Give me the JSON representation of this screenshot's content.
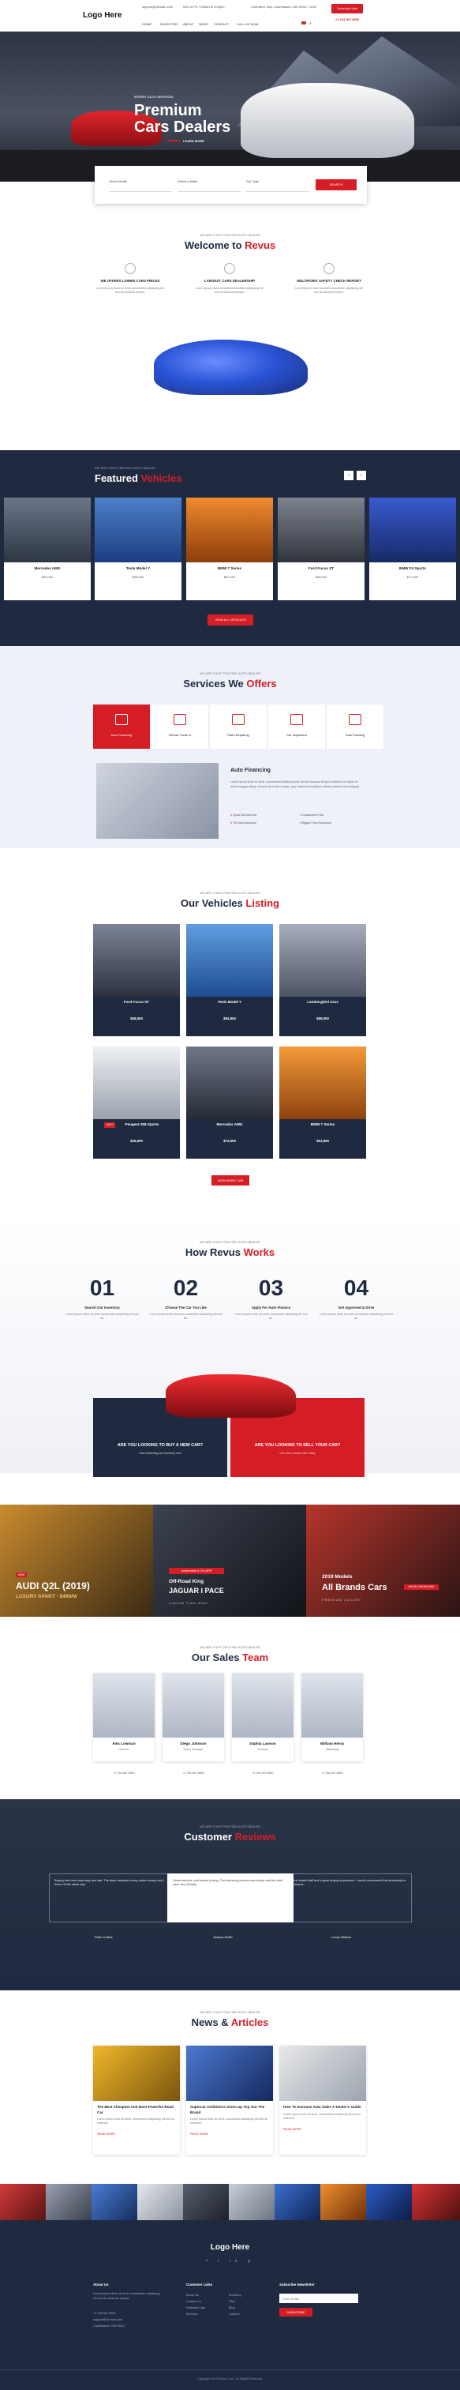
{
  "header": {
    "logo": "Logo Here",
    "email": "support@domain.com",
    "hours": "Mon to Fri: 9:00am to 6:00pm",
    "address": "Chandlers Way, Chanhassen, MN 55317, USA",
    "button": "Schedule Visit",
    "phone": "+1 234 567 8900",
    "nav": [
      "HOME",
      "INVENTORY",
      "ABOUT",
      "NEWS",
      "CONTACT",
      "CALL US NOW"
    ]
  },
  "hero": {
    "kicker": "EXPERT AUTO SERVICES",
    "title_line1": "Premium",
    "title_line2": "Cars Dealers",
    "button": "LEARN MORE"
  },
  "search": {
    "fields": [
      "Select Model",
      "Select a Make",
      "Car Type"
    ],
    "button": "SEARCH"
  },
  "welcome": {
    "kicker": "WE ARE YOUR TRUSTED AUTO DEALER",
    "title": "Welcome to",
    "title_accent": "Revus",
    "features": [
      {
        "title": "WE OFFERS LOWER CARS PRICES",
        "text": "Lorem ipsum dolor sit amet consectetur adipiscing elit sed do eiusmod tempor."
      },
      {
        "title": "LARGEST CARS DEALERSHIP",
        "text": "Lorem ipsum dolor sit amet consectetur adipiscing elit sed do eiusmod tempor."
      },
      {
        "title": "MULTIPOINT SAFETY CHECK REPORT",
        "text": "Lorem ipsum dolor sit amet consectetur adipiscing elit sed do eiusmod tempor."
      }
    ]
  },
  "featured": {
    "kicker": "WE ARE YOUR TRUSTED AUTO DEALER",
    "title": "Featured",
    "title_accent": "Vehicles",
    "prev": "‹",
    "next": "›",
    "vehicles": [
      {
        "name": "Mercedes AMG",
        "price": "$49,000"
      },
      {
        "name": "Tesla Model Y",
        "price": "$58,000"
      },
      {
        "name": "BMW 7 Series",
        "price": "$62,000"
      },
      {
        "name": "Ford Focus ST",
        "price": "$36,000"
      },
      {
        "name": "BMW F4 Sports",
        "price": "$71,000"
      }
    ],
    "button": "VIEW ALL VEHICLES"
  },
  "services": {
    "kicker": "WE ARE YOUR TRUSTED AUTO DEALER",
    "title": "Services We",
    "title_accent": "Offers",
    "items": [
      "Auto Financing",
      "Vehicle Trade In",
      "Parts Repairing",
      "Car Inspection",
      "Auto Painting"
    ],
    "detail_title": "Auto Financing",
    "detail_text": "Lorem ipsum dolor sit amet, consectetur adipiscing elit, sed do eiusmod tempor incididunt ut labore et dolore magna aliqua. Ut enim ad minim veniam, quis nostrud exercitation ullamco laboris nisi ut aliquip.",
    "bullets": [
      "Quick Bid Auto Mix",
      "Guaranteed Fast",
      "The Web Approval",
      "Bigger Point Response"
    ]
  },
  "listing": {
    "kicker": "WE ARE YOUR TRUSTED AUTO DEALER",
    "title": "Our Vehicles",
    "title_accent": "Listing",
    "cars": [
      {
        "name": "Ford Focus ST",
        "price": "$58,000",
        "badge": ""
      },
      {
        "name": "Tesla Model Y",
        "price": "$64,900",
        "badge": ""
      },
      {
        "name": "Lamborghini Urus",
        "price": "$89,000",
        "badge": ""
      },
      {
        "name": "Peugeot 308 Sports",
        "price": "$26,000",
        "badge": "SALE"
      },
      {
        "name": "Mercedes AMG",
        "price": "$72,500",
        "badge": ""
      },
      {
        "name": "BMW 7 Series",
        "price": "$51,900",
        "badge": ""
      }
    ],
    "button": "VIEW MORE CAR"
  },
  "works": {
    "kicker": "WE ARE YOUR TRUSTED AUTO DEALER",
    "title": "How Revus",
    "title_accent": "Works",
    "steps": [
      {
        "num": "01",
        "title": "Search Our Inventory",
        "text": "Lorem ipsum dolor sit amet consectetur adipiscing elit sed do."
      },
      {
        "num": "02",
        "title": "Choose The Car You Like",
        "text": "Lorem ipsum dolor sit amet consectetur adipiscing elit sed do."
      },
      {
        "num": "03",
        "title": "Apply For Auto Finance",
        "text": "Lorem ipsum dolor sit amet consectetur adipiscing elit sed do."
      },
      {
        "num": "04",
        "title": "Get Approved & Drive",
        "text": "Lorem ipsum dolor sit amet consectetur adipiscing elit sed do."
      }
    ]
  },
  "promo": {
    "buy_title": "ARE YOU LOOKING TO BUY A NEW CAR?",
    "buy_text": "Start searching our inventory now",
    "sell_title": "ARE YOU LOOKING TO SELL YOUR CAR?",
    "sell_text": "Get a free instant offer today"
  },
  "banners": [
    {
      "tag": "NEW",
      "title": "AUDI Q2L (2019)",
      "sub": "LUXURY APART - $499/M"
    },
    {
      "tag": "Achievable 5.2% APR",
      "title": "Off-Road King",
      "sub": "JAGUAR I PACE",
      "note": "Limited Time Offer"
    },
    {
      "tag": "",
      "title": "2019 Models",
      "sub": "All Brands Cars",
      "badge": "MODEL SHOWCASE",
      "note": "PREMIUM LUXURY"
    }
  ],
  "team": {
    "kicker": "WE ARE YOUR TRUSTED AUTO DEALER",
    "title": "Our Sales",
    "title_accent": "Team",
    "members": [
      {
        "name": "Alex Lowman",
        "role": "Director",
        "phone": "+1 234 567 8900"
      },
      {
        "name": "Diego Johnson",
        "role": "Sales Manager",
        "phone": "+1 234 567 8900"
      },
      {
        "name": "Sophia Lawson",
        "role": "Finance",
        "phone": "+1 234 567 8900"
      },
      {
        "name": "William Henry",
        "role": "Marketing",
        "phone": "+1 234 567 8900"
      }
    ]
  },
  "reviews": {
    "kicker": "WE ARE YOUR TRUSTED AUTO DEALER",
    "title": "Customer",
    "title_accent": "Reviews",
    "items": [
      {
        "text": "Buying from here was easy and fast. The team explained every option clearly and I drove off the same day.",
        "name": "Peter Collins"
      },
      {
        "text": "Great selection and honest pricing. The financing process was simple and the staff were very friendly.",
        "name": "Jessica Smith"
      },
      {
        "text": "Very helpful staff and a great buying experience. I would recommend this dealership to everyone.",
        "name": "Lucas Watson"
      }
    ]
  },
  "news": {
    "kicker": "WE ARE YOUR TRUSTED AUTO DEALER",
    "title": "News &",
    "title_accent": "Articles",
    "read_more": "READ MORE",
    "posts": [
      {
        "title": "The Best Cheapest And Most Powerful Road Car",
        "text": "Lorem ipsum dolor sit amet, consectetur adipiscing elit sed do eiusmod."
      },
      {
        "title": "Supercar Antibiotics Given Up Top Out The Brand",
        "text": "Lorem ipsum dolor sit amet, consectetur adipiscing elit sed do eiusmod."
      },
      {
        "title": "How To Increase Auto Sales A Dealer's Guide",
        "text": "Lorem ipsum dolor sit amet, consectetur adipiscing elit sed do eiusmod."
      }
    ]
  },
  "footer": {
    "logo": "Logo Here",
    "about_title": "About Us",
    "about_text": "Lorem ipsum dolor sit amet consectetur adipiscing elit sed do eiusmod tempor.",
    "links_title": "Customer Links",
    "links": [
      "About Us",
      "Contact Us",
      "Featured Cars",
      "Services",
      "Inventory",
      "FAQ",
      "Blog",
      "Careers"
    ],
    "newsletter_title": "Subscribe Newsletter",
    "newsletter_placeholder": "Enter Email",
    "newsletter_button": "SUBSCRIBE",
    "contact": [
      "+1 234 567 8900",
      "support@domain.com",
      "Chanhassen, MN 55317"
    ],
    "copyright": "Copyright 2023 Revus Cars. All Rights Reserved."
  }
}
